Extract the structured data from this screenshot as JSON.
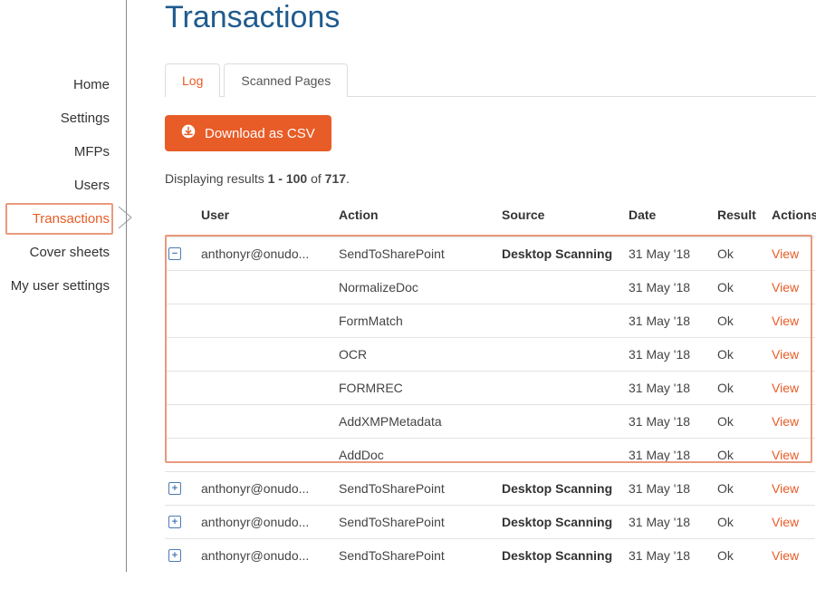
{
  "page_title": "Transactions",
  "sidebar": {
    "items": [
      {
        "label": "Home"
      },
      {
        "label": "Settings"
      },
      {
        "label": "MFPs"
      },
      {
        "label": "Users"
      },
      {
        "label": "Transactions",
        "active": true
      },
      {
        "label": "Cover sheets"
      },
      {
        "label": "My user settings"
      }
    ]
  },
  "tabs": [
    {
      "label": "Log",
      "active": true
    },
    {
      "label": "Scanned Pages"
    }
  ],
  "download_button": "Download as CSV",
  "results": {
    "prefix": "Displaying results ",
    "range": "1 - 100",
    "mid": " of ",
    "total": "717",
    "suffix": "."
  },
  "columns": [
    "User",
    "Action",
    "Source",
    "Date",
    "Result",
    "Actions"
  ],
  "rows": [
    {
      "expanded": true,
      "user": "anthonyr@onudo...",
      "action": "SendToSharePoint",
      "source": "Desktop Scanning",
      "date": "31 May '18",
      "result": "Ok",
      "actions": "View",
      "alt": false
    },
    {
      "expanded": null,
      "user": "",
      "action": "NormalizeDoc",
      "source": "",
      "date": "31 May '18",
      "result": "Ok",
      "actions": "View",
      "alt": true
    },
    {
      "expanded": null,
      "user": "",
      "action": "FormMatch",
      "source": "",
      "date": "31 May '18",
      "result": "Ok",
      "actions": "View",
      "alt": false
    },
    {
      "expanded": null,
      "user": "",
      "action": "OCR",
      "source": "",
      "date": "31 May '18",
      "result": "Ok",
      "actions": "View",
      "alt": true
    },
    {
      "expanded": null,
      "user": "",
      "action": "FORMREC",
      "source": "",
      "date": "31 May '18",
      "result": "Ok",
      "actions": "View",
      "alt": false
    },
    {
      "expanded": null,
      "user": "",
      "action": "AddXMPMetadata",
      "source": "",
      "date": "31 May '18",
      "result": "Ok",
      "actions": "View",
      "alt": true
    },
    {
      "expanded": null,
      "user": "",
      "action": "AddDoc",
      "source": "",
      "date": "31 May '18",
      "result": "Ok",
      "actions": "View",
      "alt": false
    },
    {
      "expanded": false,
      "user": "anthonyr@onudo...",
      "action": "SendToSharePoint",
      "source": "Desktop Scanning",
      "date": "31 May '18",
      "result": "Ok",
      "actions": "View",
      "alt": true
    },
    {
      "expanded": false,
      "user": "anthonyr@onudo...",
      "action": "SendToSharePoint",
      "source": "Desktop Scanning",
      "date": "31 May '18",
      "result": "Ok",
      "actions": "View",
      "alt": false
    },
    {
      "expanded": false,
      "user": "anthonyr@onudo...",
      "action": "SendToSharePoint",
      "source": "Desktop Scanning",
      "date": "31 May '18",
      "result": "Ok",
      "actions": "View",
      "alt": true
    }
  ],
  "icons": {
    "expand": "+",
    "collapse": "−"
  }
}
